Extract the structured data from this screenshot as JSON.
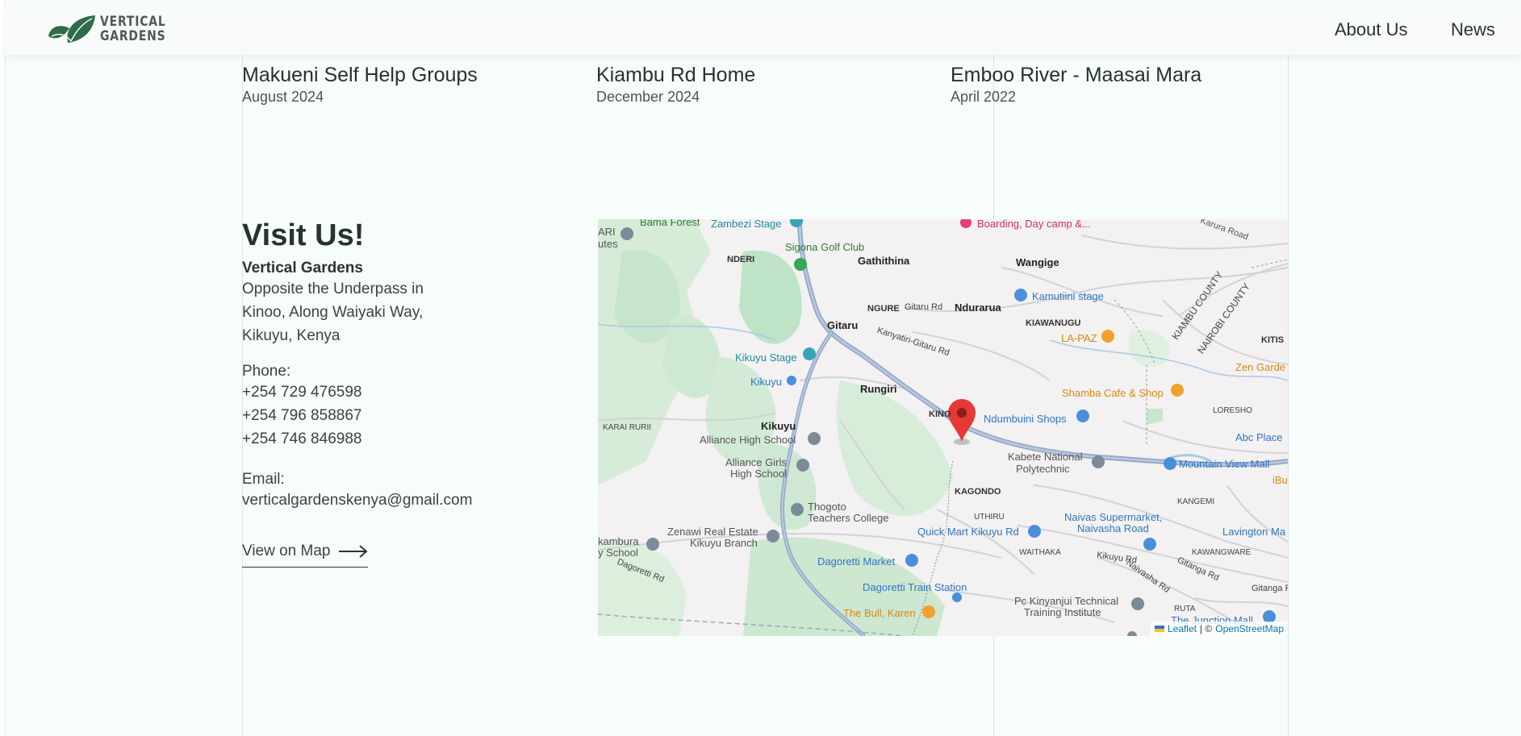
{
  "header": {
    "logo_line1": "VERTICAL",
    "logo_line2": "GARDENS",
    "nav": [
      "About Us",
      "News"
    ]
  },
  "projects": [
    {
      "title": "Makueni Self Help Groups",
      "date": "August 2024"
    },
    {
      "title": "Kiambu Rd Home",
      "date": "December 2024"
    },
    {
      "title": "Emboo River - Maasai Mara",
      "date": "April 2022"
    }
  ],
  "visit": {
    "heading": "Visit Us!",
    "company": "Vertical Gardens",
    "address": [
      "Opposite the Underpass in",
      "Kinoo, Along Waiyaki Way,",
      "Kikuyu, Kenya"
    ],
    "phone_label": "Phone:",
    "phones": [
      "+254 729 476598",
      "+254 796 858867",
      "+254 746 846988"
    ],
    "email_label": "Email:",
    "email": "verticalgardenskenya@gmail.com",
    "map_link": "View on Map"
  },
  "map": {
    "attribution_leaflet": "Leaflet",
    "attribution_sep": "| ©",
    "attribution_osm": "OpenStreetMap",
    "labels": {
      "bama_forest": "Bama Forest",
      "zambezi_stage": "Zambezi Stage",
      "boarding": "Boarding, Day camp &...",
      "karura_road": "Karura Road",
      "ari_utes": "ARI\nutes",
      "nderi": "NDERI",
      "sigona": "Sigona Golf Club",
      "gathithina": "Gathithina",
      "wangige": "Wangige",
      "kamutiini": "Kamutiini stage",
      "nguree": "NGURE",
      "gitaru_rd": "Gitaru Rd",
      "ndurarua": "Ndurarua",
      "kiambu_county": "KIAMBU COUNTY",
      "nairobi_county": "NAIROBI COUNTY",
      "gitaru": "Gitaru",
      "kiawanugu": "KIAWANUGU",
      "lapaz": "LA-PAZ",
      "kitis": "KITIS",
      "kanyatiri": "Kanyatiri-Gitaru Rd",
      "kikuyu_stage": "Kikuyu Stage",
      "zen_garden": "Zen Garde",
      "kikuyu_station": "Kikuyu",
      "rungiri": "Rungiri",
      "shamba": "Shamba Cafe & Shop",
      "loresho": "LORESHO",
      "kinoo": "KINO",
      "ndumbuini": "Ndumbuini Shops",
      "karai_rurii": "KARAI RURII",
      "kikuyu": "Kikuyu",
      "alliance_high": "Alliance High School",
      "abc_place": "Abc Place",
      "kabete_national": "Kabete National",
      "polytechnic": "Polytechnic",
      "mountain_view": "Mountain View Mall",
      "alliance_girls": "Alliance Girls",
      "high_school": "High School",
      "ibu": "iBu",
      "kagondo": "KAGONDO",
      "kangemi": "KANGEMI",
      "thogoto": "Thogoto",
      "teachers_college": "Teachers College",
      "uthiru": "UTHIRU",
      "naivas_supermarket": "Naivas Supermarket,",
      "naivasha_road": "Naivasha Road",
      "zenawi": "Zenawi Real Estate",
      "kikuyu_branch": "Kikuyu Branch",
      "quick_mart": "Quick Mart Kikuyu Rd",
      "lavington": "Lavington Ma",
      "kambura": "kambura",
      "y_school": "y School",
      "waithaka": "WAITHAKA",
      "kikuyu_rd": "Kikuyu Rd",
      "kawangware": "KAWANGWARE",
      "gitanga_rd": "Gitanga Rd",
      "dagoretti_rd": "Dagoretti Rd",
      "dagoretti_market": "Dagoretti Market",
      "naivasha_rd": "Naivasha Rd",
      "gitanga_r2": "Gitanga R",
      "dagoretti_train": "Dagoretti Train Station",
      "pc_kinyanjui": "Pc Kinyanjui Technical",
      "training_institute": "Training Institute",
      "the_bull": "The Bull, Karen",
      "ruirta": "RUTA",
      "junction_mall": "The Junction Mall"
    }
  }
}
